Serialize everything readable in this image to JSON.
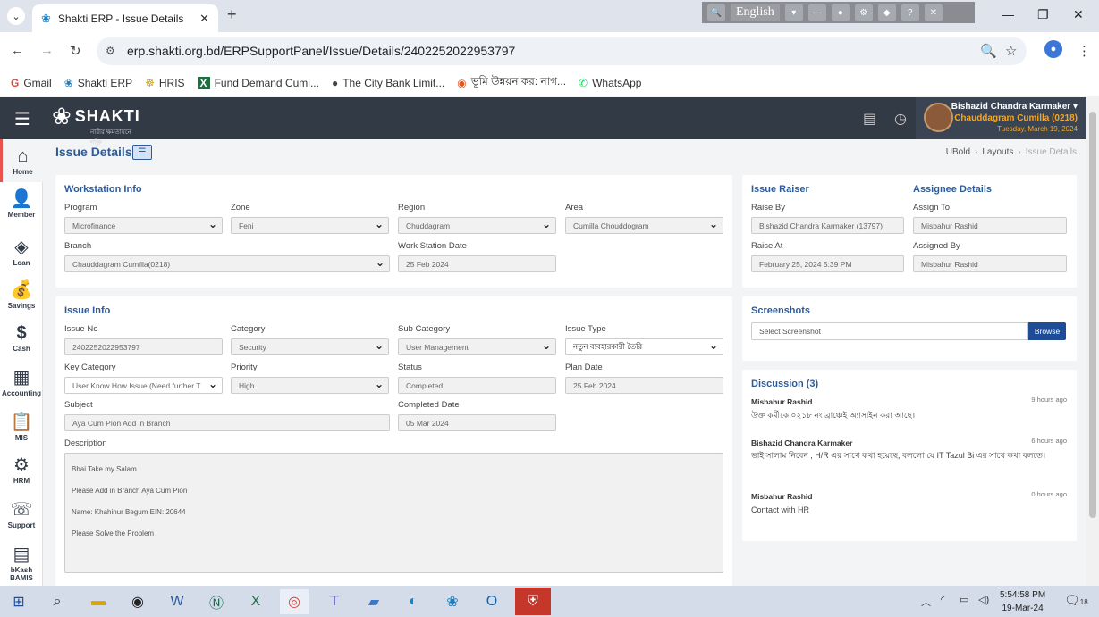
{
  "browser": {
    "tab_title": "Shakti ERP - Issue Details",
    "url": "erp.shakti.org.bd/ERPSupportPanel/Issue/Details/2402252022953797",
    "accessibility_lang": "English",
    "bookmarks": [
      {
        "label": "Gmail",
        "icon": "G"
      },
      {
        "label": "Shakti ERP",
        "icon": "❀"
      },
      {
        "label": "HRIS",
        "icon": "☸"
      },
      {
        "label": "Fund Demand Cumi...",
        "icon": "X"
      },
      {
        "label": "The City Bank Limit...",
        "icon": "●"
      },
      {
        "label": "ভূমি উন্নয়ন কর: নাগ...",
        "icon": "◉"
      },
      {
        "label": "WhatsApp",
        "icon": "✆"
      }
    ]
  },
  "header": {
    "brand": "SHAKTI",
    "brand_tagline": "নারীর ক্ষমতায়নে শক্তি",
    "user_name": "Bishazid Chandra Karmaker",
    "user_branch": "Chauddagram Cumilla (0218)",
    "user_date": "Tuesday, March 19, 2024"
  },
  "sidebar": {
    "items": [
      {
        "label": "Home",
        "icon": "⌂"
      },
      {
        "label": "Member",
        "icon": "👤"
      },
      {
        "label": "Loan",
        "icon": "◈"
      },
      {
        "label": "Savings",
        "icon": "💰"
      },
      {
        "label": "Cash",
        "icon": "$"
      },
      {
        "label": "Accounting",
        "icon": "▦"
      },
      {
        "label": "MIS",
        "icon": "📋"
      },
      {
        "label": "HRM",
        "icon": "⚙"
      },
      {
        "label": "Support",
        "icon": "☏"
      },
      {
        "label": "bKash BAMIS",
        "icon": "▤"
      }
    ]
  },
  "page": {
    "title": "Issue Details",
    "breadcrumb": [
      "UBold",
      "Layouts",
      "Issue Details"
    ]
  },
  "workstation": {
    "title": "Workstation Info",
    "program_label": "Program",
    "program": "Microfinance",
    "zone_label": "Zone",
    "zone": "Feni",
    "region_label": "Region",
    "region": "Chuddagram",
    "area_label": "Area",
    "area": "Cumilla Chouddogram",
    "branch_label": "Branch",
    "branch": "Chauddagram Cumilla(0218)",
    "date_label": "Work Station Date",
    "date": "25 Feb 2024"
  },
  "raiser": {
    "title": "Issue Raiser",
    "raise_by_label": "Raise By",
    "raise_by": "Bishazid Chandra Karmaker   (13797)",
    "raise_at_label": "Raise At",
    "raise_at": "February 25, 2024 5:39 PM"
  },
  "assignee": {
    "title": "Assignee Details",
    "assign_to_label": "Assign To",
    "assign_to": "Misbahur  Rashid",
    "assigned_by_label": "Assigned By",
    "assigned_by": "Misbahur  Rashid"
  },
  "issue": {
    "title": "Issue Info",
    "issue_no_label": "Issue No",
    "issue_no": "2402252022953797",
    "category_label": "Category",
    "category": "Security",
    "sub_category_label": "Sub Category",
    "sub_category": "User Management",
    "issue_type_label": "Issue Type",
    "issue_type": "নতুন ব্যবহারকারী তৈরি",
    "key_category_label": "Key Category",
    "key_category": "User Know How Issue (Need further T",
    "priority_label": "Priority",
    "priority": "High",
    "status_label": "Status",
    "status": "Completed",
    "plan_date_label": "Plan Date",
    "plan_date": "25 Feb 2024",
    "subject_label": "Subject",
    "subject": "Aya Cum Pion Add in Branch",
    "completed_date_label": "Completed Date",
    "completed_date": "05 Mar 2024",
    "description_label": "Description",
    "description_lines": [
      "Bhai Take my Salam",
      "Please Add in Branch  Aya Cum Pion",
      "Name: Khahinur Begum   EIN: 20644",
      "Please  Solve the Problem"
    ]
  },
  "screenshots": {
    "title": "Screenshots",
    "placeholder": "Select Screenshot",
    "browse_label": "Browse"
  },
  "discussion": {
    "title": "Discussion (3)",
    "messages": [
      {
        "name": "Misbahur Rashid",
        "time": "9 hours ago",
        "text": "উক্ত কর্মীকে ০২১৮ নং ব্রাঞ্চেই অ্যাসাইন করা আছে।"
      },
      {
        "name": "Bishazid Chandra Karmaker",
        "time": "6 hours ago",
        "text": "ভাই সালাম নিবেন , H/R এর সাথে কথা হয়েছে, বললো যে IT Tazul Bi এর সাথে কথা বলতে।"
      },
      {
        "name": "Misbahur Rashid",
        "time": "0 hours ago",
        "text": "Contact with HR"
      }
    ]
  },
  "taskbar": {
    "time": "5:54:58 PM",
    "date": "19-Mar-24",
    "notifications": "18"
  }
}
